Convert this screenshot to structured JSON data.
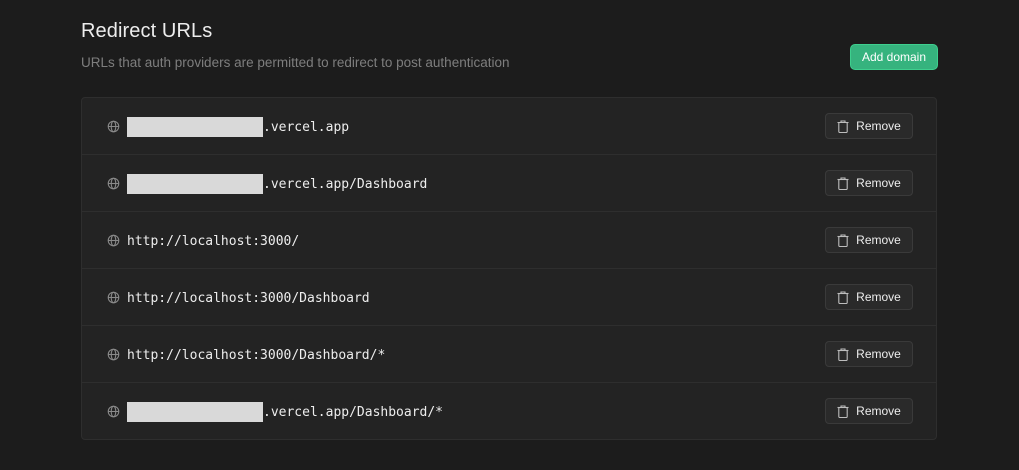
{
  "section": {
    "title": "Redirect URLs",
    "subtitle": "URLs that auth providers are permitted to redirect to post authentication",
    "add_button_label": "Add domain"
  },
  "urls": [
    {
      "redacted_prefix": true,
      "text": ".vercel.app",
      "remove_label": "Remove"
    },
    {
      "redacted_prefix": true,
      "text": ".vercel.app/Dashboard",
      "remove_label": "Remove"
    },
    {
      "redacted_prefix": false,
      "text": "http://localhost:3000/",
      "remove_label": "Remove"
    },
    {
      "redacted_prefix": false,
      "text": "http://localhost:3000/Dashboard",
      "remove_label": "Remove"
    },
    {
      "redacted_prefix": false,
      "text": "http://localhost:3000/Dashboard/*",
      "remove_label": "Remove"
    },
    {
      "redacted_prefix": true,
      "text": ".vercel.app/Dashboard/*",
      "remove_label": "Remove"
    }
  ],
  "icons": {
    "row_icon": "globe-icon",
    "remove_icon": "trash-icon"
  },
  "colors": {
    "background": "#1c1c1c",
    "panel": "#232323",
    "border": "#2e2e2e",
    "accent": "#3ecf8e",
    "text": "#ededed",
    "muted": "#7e7e7e"
  }
}
